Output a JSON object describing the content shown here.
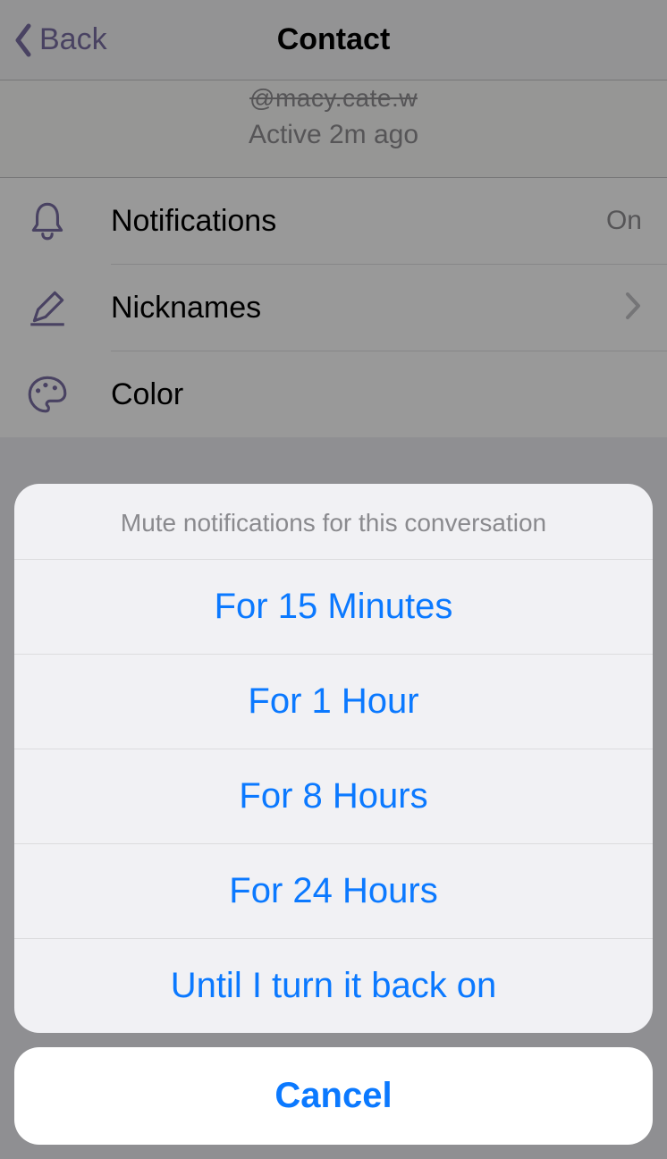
{
  "nav": {
    "back_label": "Back",
    "title": "Contact"
  },
  "profile": {
    "handle": "@macy.cate.w",
    "status": "Active 2m ago"
  },
  "rows": {
    "notifications": {
      "label": "Notifications",
      "value": "On"
    },
    "nicknames": {
      "label": "Nicknames"
    },
    "color": {
      "label": "Color"
    }
  },
  "sheet": {
    "title": "Mute notifications for this conversation",
    "options": [
      "For 15 Minutes",
      "For 1 Hour",
      "For 8 Hours",
      "For 24 Hours",
      "Until I turn it back on"
    ],
    "cancel": "Cancel"
  }
}
